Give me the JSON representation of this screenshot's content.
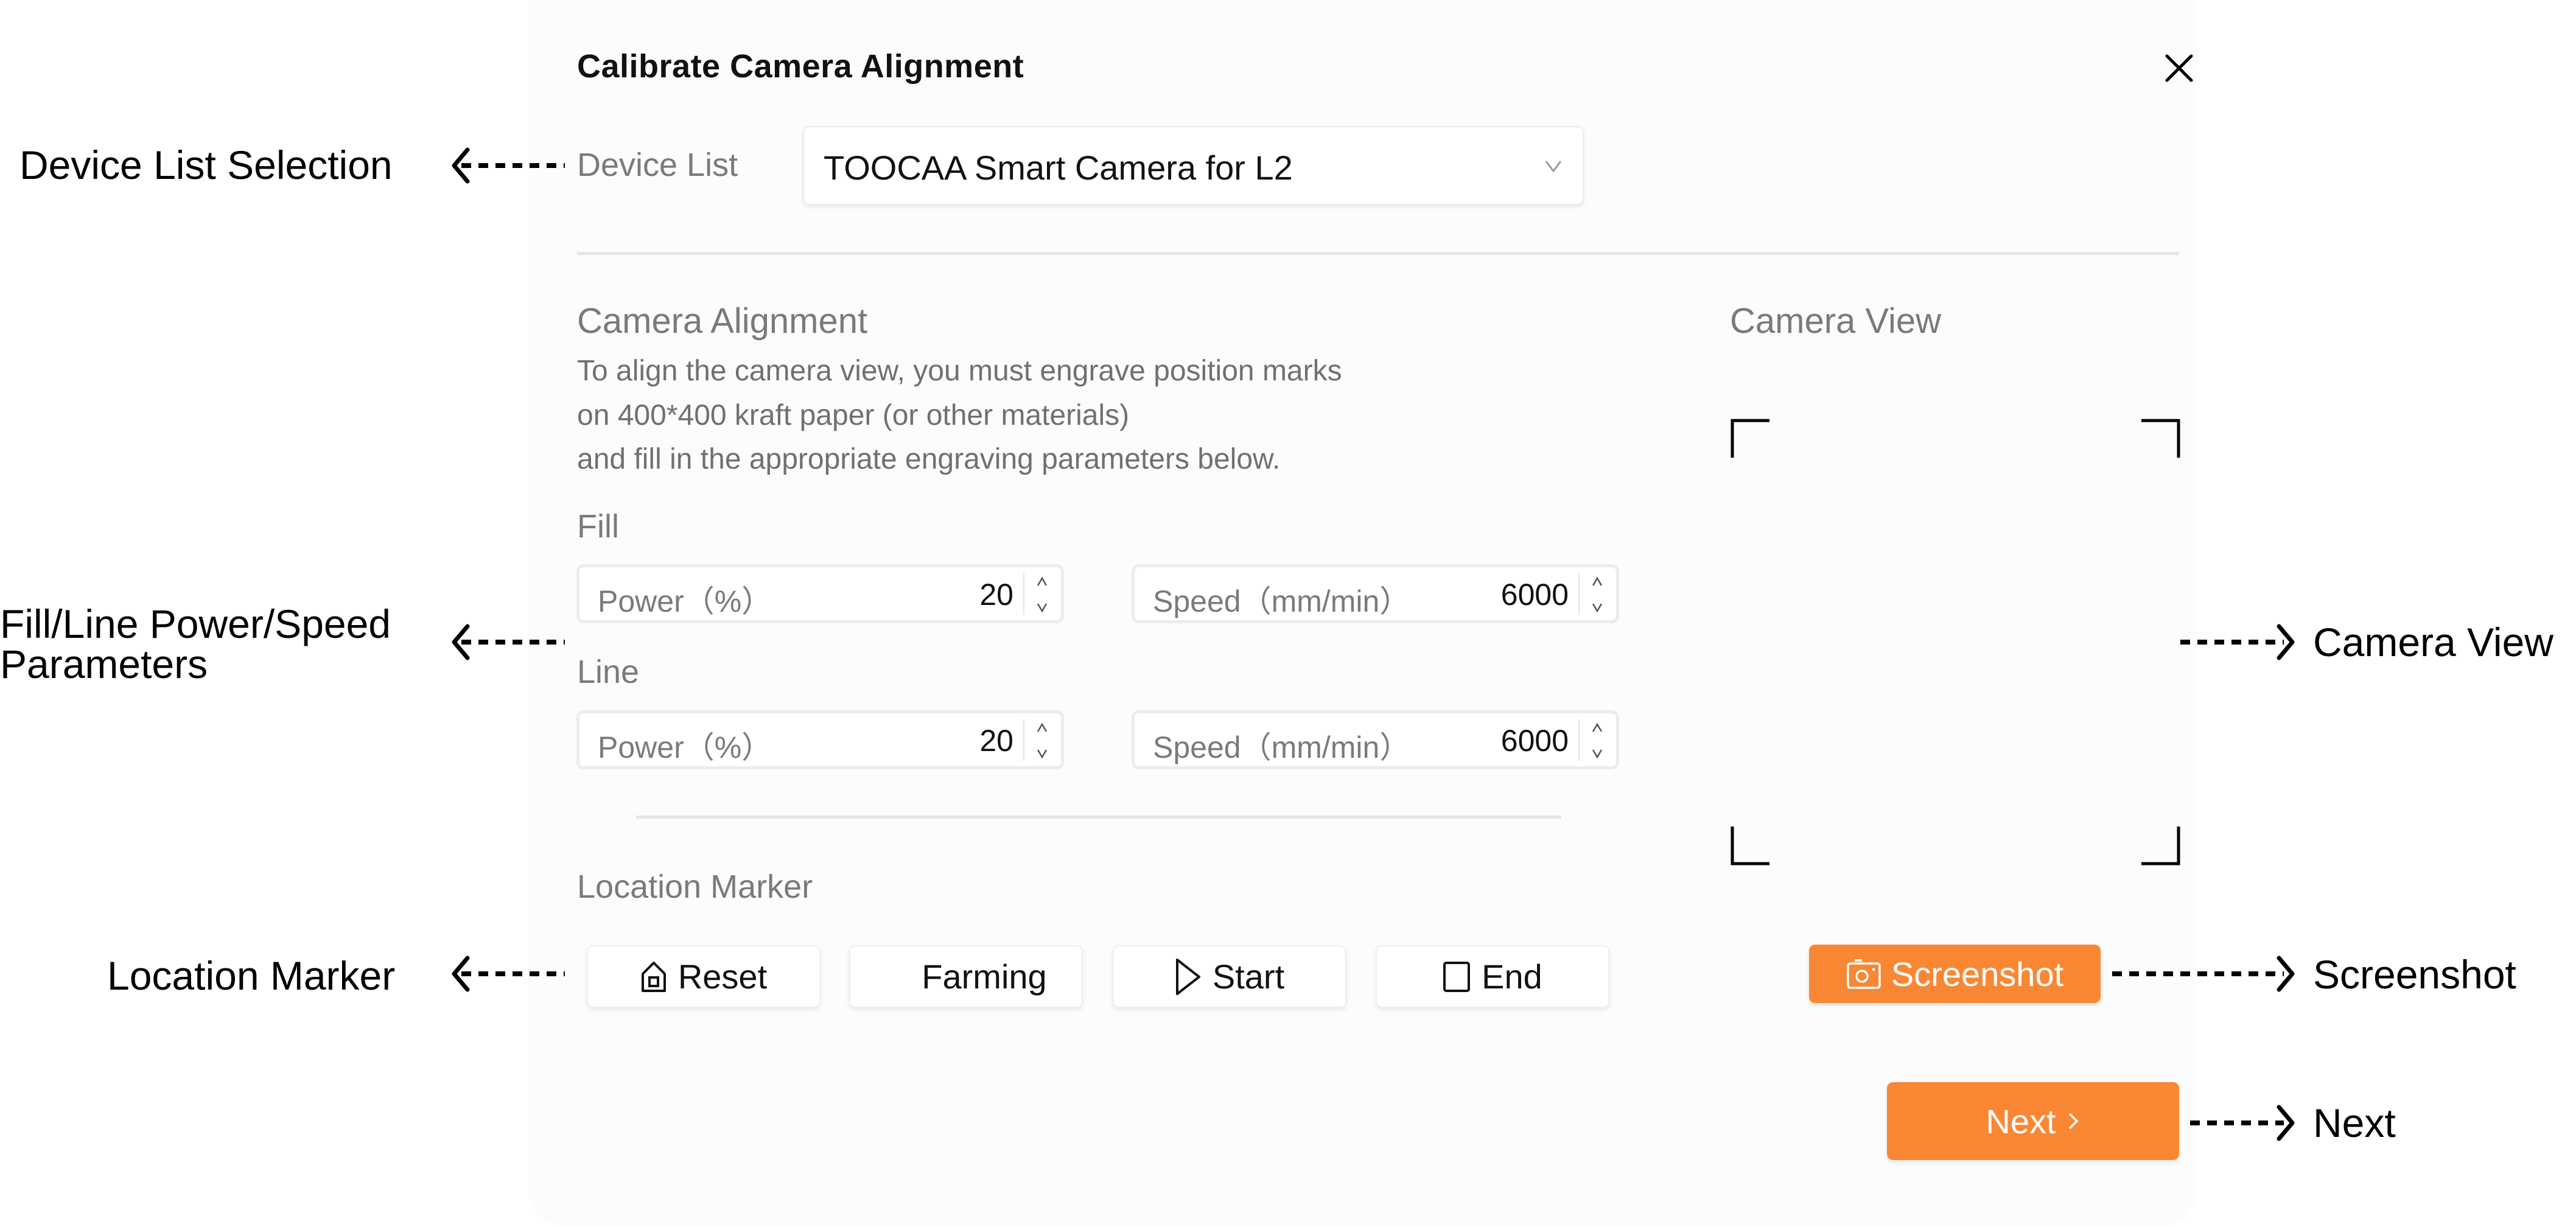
{
  "dialog": {
    "title": "Calibrate Camera Alignment",
    "close_icon": "close-icon"
  },
  "device": {
    "label": "Device List",
    "selected": "TOOCAA Smart Camera for L2",
    "chevron_icon": "chevron-down-icon"
  },
  "alignment": {
    "heading": "Camera Alignment",
    "description": [
      "To align the camera view, you must engrave position marks",
      "on 400*400 kraft paper (or other materials)",
      "and fill in the appropriate engraving parameters below."
    ],
    "fill": {
      "label": "Fill",
      "power": {
        "label": "Power（%）",
        "value": "20"
      },
      "speed": {
        "label": "Speed（mm/min）",
        "value": "6000"
      }
    },
    "line": {
      "label": "Line",
      "power": {
        "label": "Power（%）",
        "value": "20"
      },
      "speed": {
        "label": "Speed（mm/min）",
        "value": "6000"
      }
    }
  },
  "location_marker": {
    "heading": "Location Marker",
    "buttons": [
      {
        "label": "Reset",
        "icon": "home-icon"
      },
      {
        "label": "Farming",
        "icon": ""
      },
      {
        "label": "Start",
        "icon": "play-icon"
      },
      {
        "label": "End",
        "icon": "stop-icon"
      }
    ]
  },
  "camera_view": {
    "heading": "Camera View",
    "screenshot_label": "Screenshot",
    "screenshot_icon": "camera-icon"
  },
  "footer": {
    "next_label": "Next",
    "next_icon": "chevron-right-icon"
  },
  "annotations": {
    "device_list": "Device List Selection",
    "parameters_line1": "Fill/Line Power/Speed",
    "parameters_line2": "Parameters",
    "location_marker": "Location Marker",
    "camera_view": "Camera View",
    "screenshot": "Screenshot",
    "next": "Next"
  },
  "colors": {
    "accent": "#F98733",
    "dialog_bg": "#FCFCFC",
    "label_gray": "#7A7A7A",
    "divider": "#E6E5E3"
  }
}
